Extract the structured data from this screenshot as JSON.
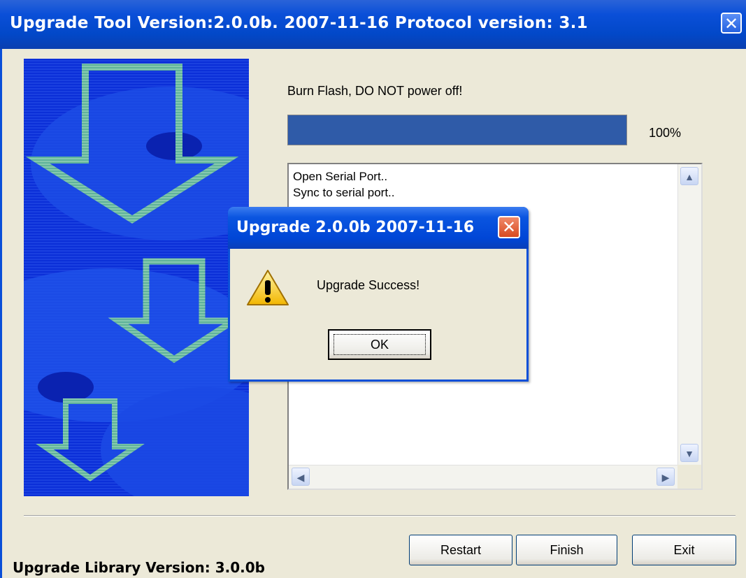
{
  "window": {
    "title": "Upgrade Tool Version:2.0.0b. 2007-11-16 Protocol version: 3.1",
    "close_glyph": "✕"
  },
  "status": {
    "message": "Burn Flash, DO NOT power off!",
    "progress_percent": 100,
    "progress_label": "100%"
  },
  "log": {
    "lines": [
      "Open Serial Port..",
      "Sync to serial port.."
    ],
    "scroll_up_glyph": "▲",
    "scroll_down_glyph": "▼",
    "scroll_left_glyph": "◀",
    "scroll_right_glyph": "▶"
  },
  "buttons": {
    "restart": "Restart",
    "finish": "Finish",
    "exit": "Exit"
  },
  "footer": {
    "library_version": "Upgrade Library Version: 3.0.0b"
  },
  "dialog": {
    "title": "Upgrade 2.0.0b 2007-11-16",
    "message": "Upgrade Success!",
    "ok_label": "OK",
    "close_glyph": "✕",
    "icon": "warning-icon"
  },
  "colors": {
    "titlebar_blue": "#0a4fd8",
    "progress_fill": "#2f5ba8",
    "banner_blue": "#0a2ad0",
    "dialog_close_red": "#d84a20"
  }
}
